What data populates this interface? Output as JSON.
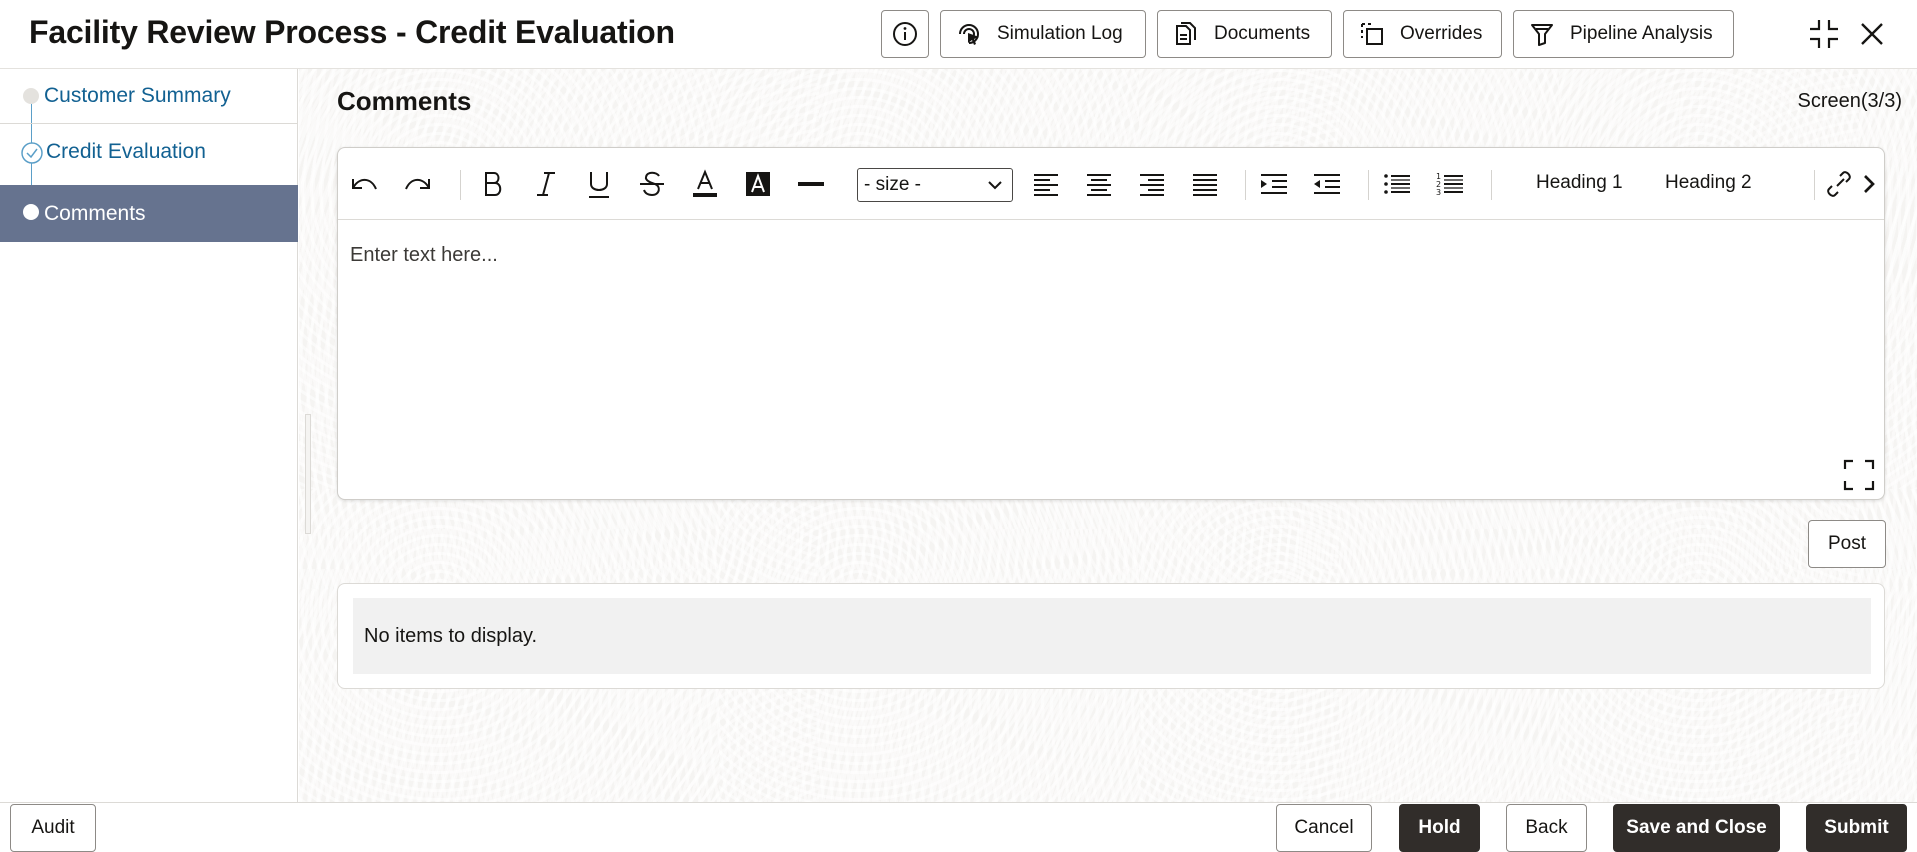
{
  "header": {
    "title": "Facility Review Process - Credit Evaluation",
    "buttons": {
      "simulation_log": "Simulation Log",
      "documents": "Documents",
      "overrides": "Overrides",
      "pipeline_analysis": "Pipeline Analysis"
    },
    "icons": [
      "info-icon",
      "cursor-click-icon",
      "documents-icon",
      "overrides-icon",
      "funnel-icon",
      "collapse-icon",
      "close-icon"
    ]
  },
  "sidebar": {
    "items": [
      {
        "label": "Customer Summary",
        "state": "visited"
      },
      {
        "label": "Credit Evaluation",
        "state": "completed"
      },
      {
        "label": "Comments",
        "state": "active"
      }
    ]
  },
  "main": {
    "section_title": "Comments",
    "screen_indicator": "Screen(3/3)",
    "editor": {
      "size_select": "- size -",
      "heading1": "Heading 1",
      "heading2": "Heading 2",
      "placeholder": "Enter text here..."
    },
    "post_label": "Post",
    "empty_text": "No items to display."
  },
  "footer": {
    "audit": "Audit",
    "cancel": "Cancel",
    "hold": "Hold",
    "back": "Back",
    "save_close": "Save and Close",
    "submit": "Submit"
  },
  "colors": {
    "active_nav": "#66738f",
    "link": "#126192",
    "primary_button": "#312d2a",
    "content_bg": "#f5f4f2"
  }
}
